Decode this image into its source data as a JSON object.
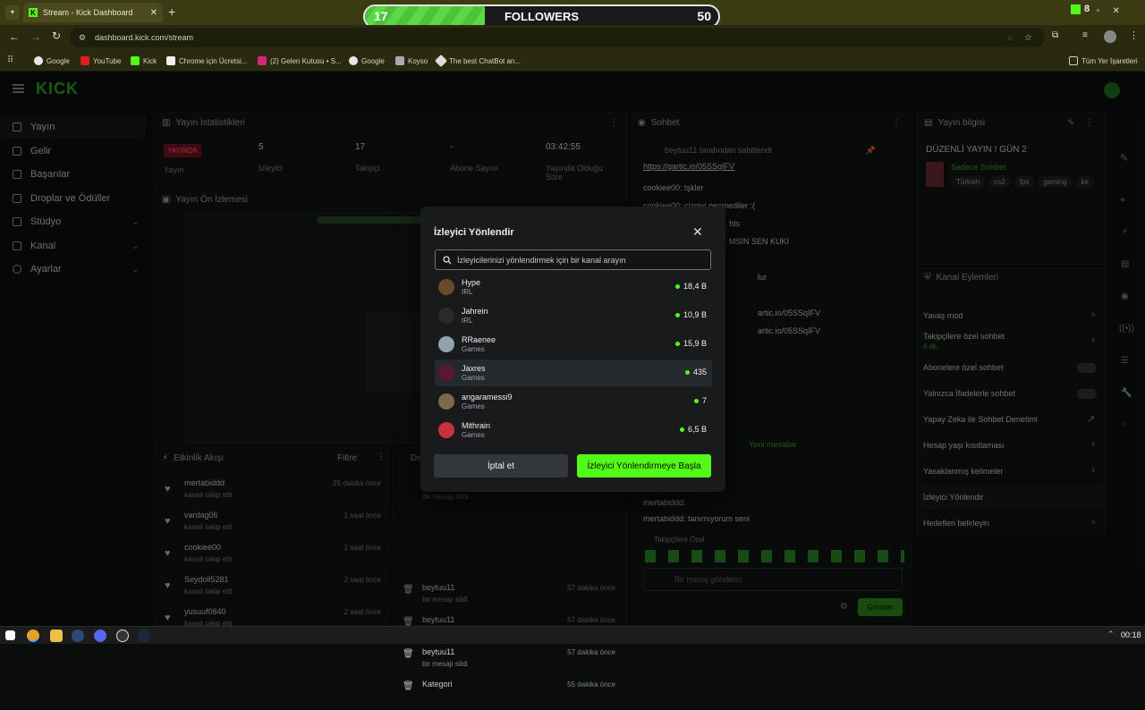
{
  "browser": {
    "tab_title": "Stream - Kick Dashboard",
    "url": "dashboard.kick.com/stream",
    "ext_badge": "8",
    "bookmarks": [
      "Google",
      "YouTube",
      "Kick",
      "Chrome için Ücretsi...",
      "(2) Gelen Kutusu • S...",
      "Google",
      "Koyso",
      "The best ChatBot an..."
    ],
    "all_bookmarks": "Tüm Yer İşaretleri"
  },
  "followers_overlay": {
    "current": "17",
    "label": "FOLLOWERS",
    "goal": "50",
    "progress": 0.34
  },
  "sidebar": {
    "items": [
      "Yayın",
      "Gelir",
      "Başarılar",
      "Droplar ve Ödüller",
      "Stüdyo",
      "Kanal",
      "Ayarlar"
    ]
  },
  "stats": {
    "title": "Yayın İstatistikleri",
    "live_badge": "YAYINDA",
    "cells": [
      {
        "value": "",
        "label": "Yayın"
      },
      {
        "value": "5",
        "label": "İzleyici"
      },
      {
        "value": "17",
        "label": "Takipçi"
      },
      {
        "value": "-",
        "label": "Abone Sayısı"
      },
      {
        "value": "03:42:55",
        "label": "Yayında Olduğu Süre"
      }
    ]
  },
  "preview": {
    "title": "Yayın Ön İzlemesi"
  },
  "activity": {
    "title": "Etkinlik Akışı",
    "filter": "Filtre",
    "items": [
      {
        "name": "mertabiddd",
        "sub": "kanalı takip etti",
        "time": "25 dakika önce"
      },
      {
        "name": "vardag06",
        "sub": "kanalı takip etti",
        "time": "1 saat önce"
      },
      {
        "name": "cookiee00",
        "sub": "kanalı takip etti",
        "time": "1 saat önce"
      },
      {
        "name": "Seydoll5281",
        "sub": "kanalı takip etti",
        "time": "2 saat önce"
      },
      {
        "name": "yusuuf0840",
        "sub": "kanalı takip etti",
        "time": "2 saat önce"
      }
    ]
  },
  "mod": {
    "header": "De",
    "items": [
      {
        "name": "beytuu11",
        "sub": "bir mesajı sildi",
        "time": "57 dakika önce"
      },
      {
        "name": "beytuu11",
        "sub": "bir mesajı sildi",
        "time": "57 dakika önce"
      },
      {
        "name": "beytuu11",
        "sub": "bir mesajı sildi",
        "time": "57 dakika önce"
      },
      {
        "name": "Kategori",
        "sub": "",
        "time": "55 dakika önce"
      }
    ],
    "top_sub": "bir mesajı sildi"
  },
  "chat": {
    "title": "Sohbet",
    "pinned_by": "beytuu11 tarafından sabitlendi",
    "pinned_link": "https://gartic.io/05SSqIFV",
    "lines": [
      "cookiee00: tşkler",
      "cookiee00: çizgivi geçmediler :(",
      "fds",
      "MSIN SEN KUKI",
      "lur",
      "artic.io/05SSqIFV",
      "artic.io/05SSqIFV"
    ],
    "new_messages": "Yeni mesajlar",
    "bottom_lines": [
      "mertabiddd:",
      "mertabiddd: tanımıyorum seni"
    ],
    "followers_only": "Takipçilere Özel",
    "input_placeholder": "Bir mesaj gönderin",
    "send": "Gönder"
  },
  "stream_info": {
    "title": "Yayın bilgisi",
    "stream_title": "DÜZENLİ YAYIN ! GÜN 2",
    "category": "Sadece Sohbet",
    "tags": [
      "Türkish",
      "cs2",
      "fps",
      "gaming",
      "ke"
    ]
  },
  "channel_actions": {
    "title": "Kanal Eylemleri",
    "items": [
      "Yavaş mod",
      "Takipçilere özel sohbet",
      "Abonelere özel sohbet",
      "Yalnızca İfadelerle sohbet",
      "Yapay Zeka ile Sohbet Denetimi",
      "Hesap yaşı kısıtlaması",
      "Yasaklanmış kelimeler",
      "İzleyici Yönlendir",
      "Hedefleri belirleyin"
    ],
    "follower_sub": "4 dk."
  },
  "modal": {
    "title": "İzleyici Yönlendir",
    "search_placeholder": "İzleyicilerinizi yönlendirmek için bir kanal arayın",
    "channels": [
      {
        "name": "Hype",
        "category": "IRL",
        "viewers": "18,4 B",
        "color": "#6b4a2a"
      },
      {
        "name": "Jahrein",
        "category": "IRL",
        "viewers": "10,9 B",
        "color": "#2a2a2a"
      },
      {
        "name": "RRaenee",
        "category": "Games",
        "viewers": "15,9 B",
        "color": "#8fa3b0"
      },
      {
        "name": "Jaxres",
        "category": "Games",
        "viewers": "435",
        "color": "#5a1830"
      },
      {
        "name": "angaramessi9",
        "category": "Games",
        "viewers": "7",
        "color": "#7a6a4a"
      },
      {
        "name": "Mithrain",
        "category": "Games",
        "viewers": "6,5 B",
        "color": "#c8303a"
      }
    ],
    "cancel": "İptal et",
    "start": "İzleyici Yönlendirmeye Başla"
  },
  "taskbar": {
    "time": "00:18"
  }
}
